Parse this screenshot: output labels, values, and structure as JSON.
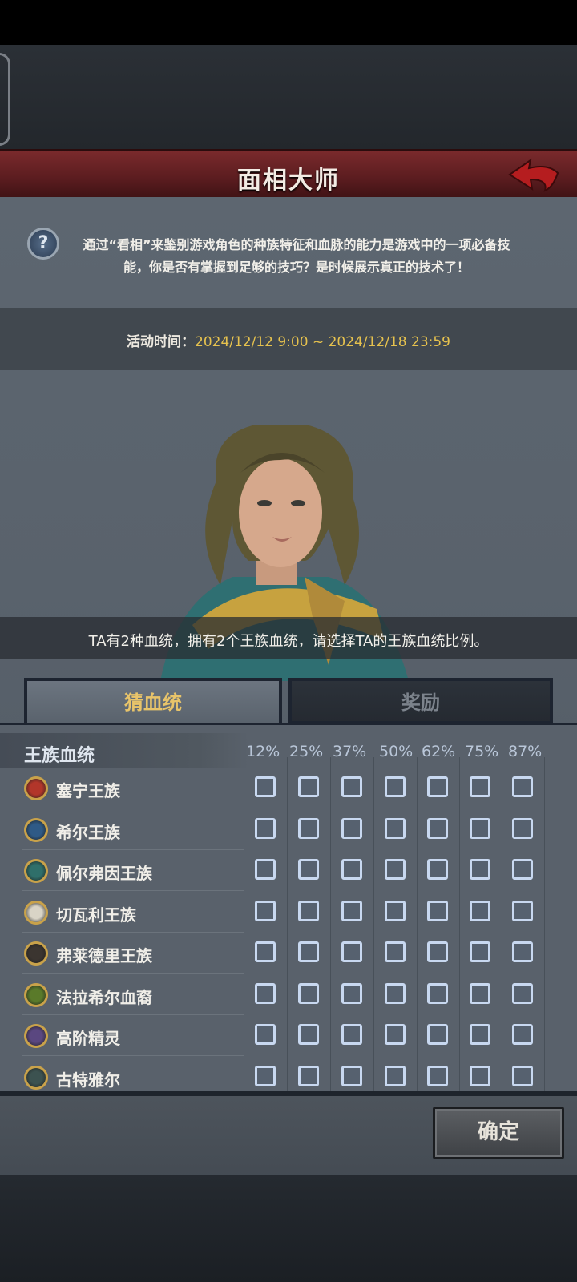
{
  "header": {
    "title": "面相大师"
  },
  "intro": {
    "text": "通过“看相”来鉴别游戏角色的种族特征和血脉的能力是游戏中的一项必备技能，你是否有掌握到足够的技巧？是时候展示真正的技术了！"
  },
  "event_time": {
    "label": "活动时间：",
    "value": "2024/12/12 9:00 ~ 2024/12/18 23:59"
  },
  "caption": "TA有2种血统，拥有2个王族血统，请选择TA的王族血统比例。",
  "tabs": [
    {
      "label": "猜血统",
      "active": true
    },
    {
      "label": "奖励",
      "active": false
    }
  ],
  "list": {
    "title": "王族血统",
    "percentages": [
      "12%",
      "25%",
      "37%",
      "50%",
      "62%",
      "75%",
      "87%"
    ],
    "rows": [
      {
        "name": "塞宁王族",
        "icon": "red-crest-icon",
        "color": "#b2362a"
      },
      {
        "name": "希尔王族",
        "icon": "blue-crest-icon",
        "color": "#2f5a86"
      },
      {
        "name": "佩尔弗因王族",
        "icon": "teal-crest-icon",
        "color": "#2f6f6a"
      },
      {
        "name": "切瓦利王族",
        "icon": "scales-icon",
        "color": "#d9d4c6"
      },
      {
        "name": "弗莱德里王族",
        "icon": "horned-crest-icon",
        "color": "#3b3530"
      },
      {
        "name": "法拉希尔血裔",
        "icon": "tree-icon",
        "color": "#5a7a2a"
      },
      {
        "name": "高阶精灵",
        "icon": "purple-crest-icon",
        "color": "#5a4780"
      },
      {
        "name": "古特雅尔",
        "icon": "dark-crest-icon",
        "color": "#3c5250"
      }
    ]
  },
  "confirm": {
    "label": "确定"
  }
}
